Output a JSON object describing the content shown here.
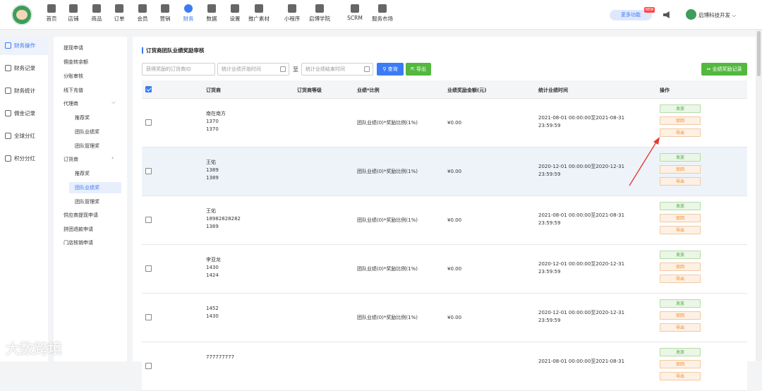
{
  "nav": {
    "items": [
      {
        "label": "首页",
        "icon": "home-icon"
      },
      {
        "label": "店铺",
        "icon": "store-icon"
      },
      {
        "label": "商品",
        "icon": "goods-icon"
      },
      {
        "label": "订单",
        "icon": "order-icon"
      },
      {
        "label": "会员",
        "icon": "member-icon"
      },
      {
        "label": "营销",
        "icon": "marketing-icon"
      },
      {
        "label": "财务",
        "icon": "finance-icon"
      },
      {
        "label": "数据",
        "icon": "data-icon"
      },
      {
        "label": "设置",
        "icon": "settings-icon"
      },
      {
        "label": "推广素材",
        "icon": "share-icon"
      },
      {
        "label": "小程序",
        "icon": "miniapp-icon"
      },
      {
        "label": "启博学院",
        "icon": "academy-icon"
      },
      {
        "label": "SCRM",
        "icon": "scrm-icon"
      },
      {
        "label": "服务市场",
        "icon": "service-icon"
      }
    ],
    "more_label": "更多功能",
    "new_badge": "NEW",
    "user_name": "启博科技开发",
    "accent": "#3b7bf5"
  },
  "left_menu": [
    {
      "label": "财务操作",
      "active": true
    },
    {
      "label": "财务记录"
    },
    {
      "label": "财务统计"
    },
    {
      "label": "佣金记录"
    },
    {
      "label": "全球分红"
    },
    {
      "label": "积分分红"
    }
  ],
  "sub_menu": [
    {
      "label": "提现申请"
    },
    {
      "label": "佣金转余额"
    },
    {
      "label": "分账审核"
    },
    {
      "label": "线下充值"
    },
    {
      "label": "代理商"
    },
    {
      "label": "推荐奖"
    },
    {
      "label": "团队业绩奖"
    },
    {
      "label": "团队管理奖"
    },
    {
      "label": "订货商"
    },
    {
      "label": "推荐奖"
    },
    {
      "label": "团队业绩奖"
    },
    {
      "label": "团队管理奖"
    },
    {
      "label": "供应商提现申请"
    },
    {
      "label": "拼团退款申请"
    },
    {
      "label": "门店核销申请"
    }
  ],
  "page": {
    "title": "订货商团队业绩奖励审核",
    "search_placeholder": "获得奖励的订货商ID",
    "start_placeholder": "统计业绩开始时间",
    "end_placeholder": "统计业绩结束时间",
    "range_sep": "至",
    "query_label": "查询",
    "export_label": "导出",
    "records_label": "业绩奖励记录"
  },
  "table": {
    "headers": [
      "订货商",
      "订货商等级",
      "业绩*比例",
      "业绩奖励金额(元)",
      "统计业绩时间",
      "操作"
    ],
    "actions": [
      "发放",
      "驳回",
      "导出"
    ],
    "rows": [
      {
        "name": "南在南方",
        "id1": "1370",
        "id2": "1370",
        "formula": "团队业绩(0)*奖励比例(1%)",
        "amount": "¥0.00",
        "time1": "2021-08-01 00:00:00至2021-08-31",
        "time2": "23:59:59"
      },
      {
        "name": "王佑",
        "id1": "1389",
        "id2": "1389",
        "formula": "团队业绩(0)*奖励比例(1%)",
        "amount": "¥0.00",
        "time1": "2020-12-01 00:00:00至2020-12-31",
        "time2": "23:59:59"
      },
      {
        "name": "王佑",
        "id1": "18982828282",
        "id2": "1389",
        "formula": "团队业绩(0)*奖励比例(1%)",
        "amount": "¥0.00",
        "time1": "2021-08-01 00:00:00至2021-08-31",
        "time2": "23:59:59"
      },
      {
        "name": "李亚龙",
        "id1": "1430",
        "id2": "1424",
        "formula": "团队业绩(0)*奖励比例(1%)",
        "amount": "¥0.00",
        "time1": "2020-12-01 00:00:00至2020-12-31",
        "time2": "23:59:59"
      },
      {
        "name": "1452",
        "id1": "1430",
        "id2": "",
        "formula": "团队业绩(0)*奖励比例(1%)",
        "amount": "¥0.00",
        "time1": "2020-12-01 00:00:00至2020-12-31",
        "time2": "23:59:59"
      },
      {
        "name": "777777777",
        "id1": "",
        "id2": "",
        "formula": "",
        "amount": "",
        "time1": "2021-08-01 00:00:00至2021-08-31",
        "time2": ""
      }
    ]
  },
  "watermark": "大数跨境"
}
